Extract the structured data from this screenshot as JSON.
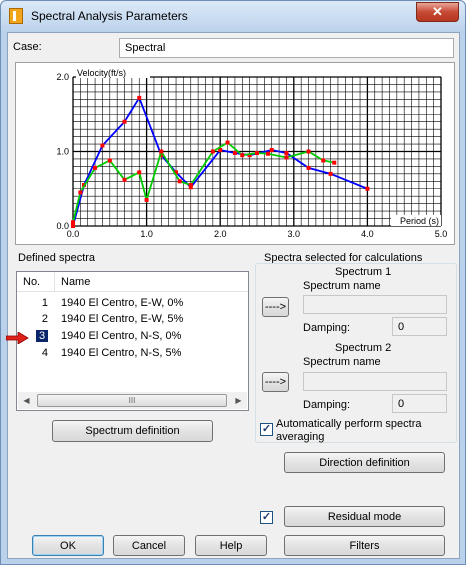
{
  "window": {
    "title": "Spectral Analysis Parameters",
    "close_glyph": "✕"
  },
  "case": {
    "label": "Case:",
    "value": "Spectral"
  },
  "chart_data": {
    "type": "line",
    "ylabel": "Velocity(ft/s)",
    "xlabel": "Period (s)",
    "xlim": [
      0,
      5
    ],
    "ylim": [
      0,
      2
    ],
    "x_ticks": [
      "0.0",
      "1.0",
      "2.0",
      "3.0",
      "4.0",
      "5.0"
    ],
    "y_ticks": [
      "0.0",
      "1.0",
      "2.0"
    ],
    "grid": true,
    "series": [
      {
        "color": "#0000ff",
        "x": [
          0.0,
          0.15,
          0.4,
          0.7,
          0.9,
          1.2,
          1.4,
          1.6,
          2.0,
          2.2,
          2.4,
          2.7,
          2.9,
          3.2,
          3.5,
          4.0
        ],
        "y": [
          0.0,
          0.55,
          1.08,
          1.4,
          1.72,
          0.95,
          0.72,
          0.52,
          1.02,
          0.98,
          0.95,
          1.02,
          0.98,
          0.78,
          0.7,
          0.5
        ]
      },
      {
        "color": "#00cc00",
        "x": [
          0.0,
          0.1,
          0.3,
          0.5,
          0.7,
          0.9,
          1.0,
          1.2,
          1.45,
          1.6,
          1.9,
          2.1,
          2.3,
          2.5,
          2.65,
          2.9,
          3.2,
          3.4,
          3.55
        ],
        "y": [
          0.05,
          0.45,
          0.78,
          0.88,
          0.62,
          0.72,
          0.35,
          1.0,
          0.6,
          0.55,
          1.0,
          1.12,
          0.95,
          0.98,
          0.97,
          0.92,
          1.0,
          0.88,
          0.85
        ]
      }
    ],
    "marker_color": "#ff0000"
  },
  "defined_spectra": {
    "label": "Defined spectra",
    "columns": [
      "No.",
      "Name"
    ],
    "rows": [
      {
        "no": "1",
        "name": "1940 El Centro, E-W, 0%"
      },
      {
        "no": "2",
        "name": "1940 El Centro, E-W, 5%"
      },
      {
        "no": "3",
        "name": "1940 El Centro, N-S, 0%"
      },
      {
        "no": "4",
        "name": "1940 El Centro, N-S, 5%"
      }
    ],
    "selected_row": "3",
    "scroll_left": "◀",
    "scroll_right": "▶",
    "scroll_grip": "III",
    "spectrum_definition_button": "Spectrum definition"
  },
  "spectra_selected": {
    "label": "Spectra selected for calculations",
    "spectrum1": {
      "title": "Spectrum 1",
      "name_label": "Spectrum name",
      "name_value": "",
      "damping_label": "Damping:",
      "damping_value": "0",
      "arrow_button": "---->"
    },
    "spectrum2": {
      "title": "Spectrum 2",
      "name_label": "Spectrum name",
      "name_value": "",
      "damping_label": "Damping:",
      "damping_value": "0",
      "arrow_button": "---->"
    },
    "auto_average": {
      "label": "Automatically perform spectra averaging",
      "checked": true,
      "check_glyph": "✓"
    }
  },
  "buttons": {
    "direction_definition": "Direction definition",
    "residual_mode": "Residual mode",
    "residual_checked": true,
    "ok": "OK",
    "cancel": "Cancel",
    "help": "Help",
    "filters": "Filters"
  }
}
